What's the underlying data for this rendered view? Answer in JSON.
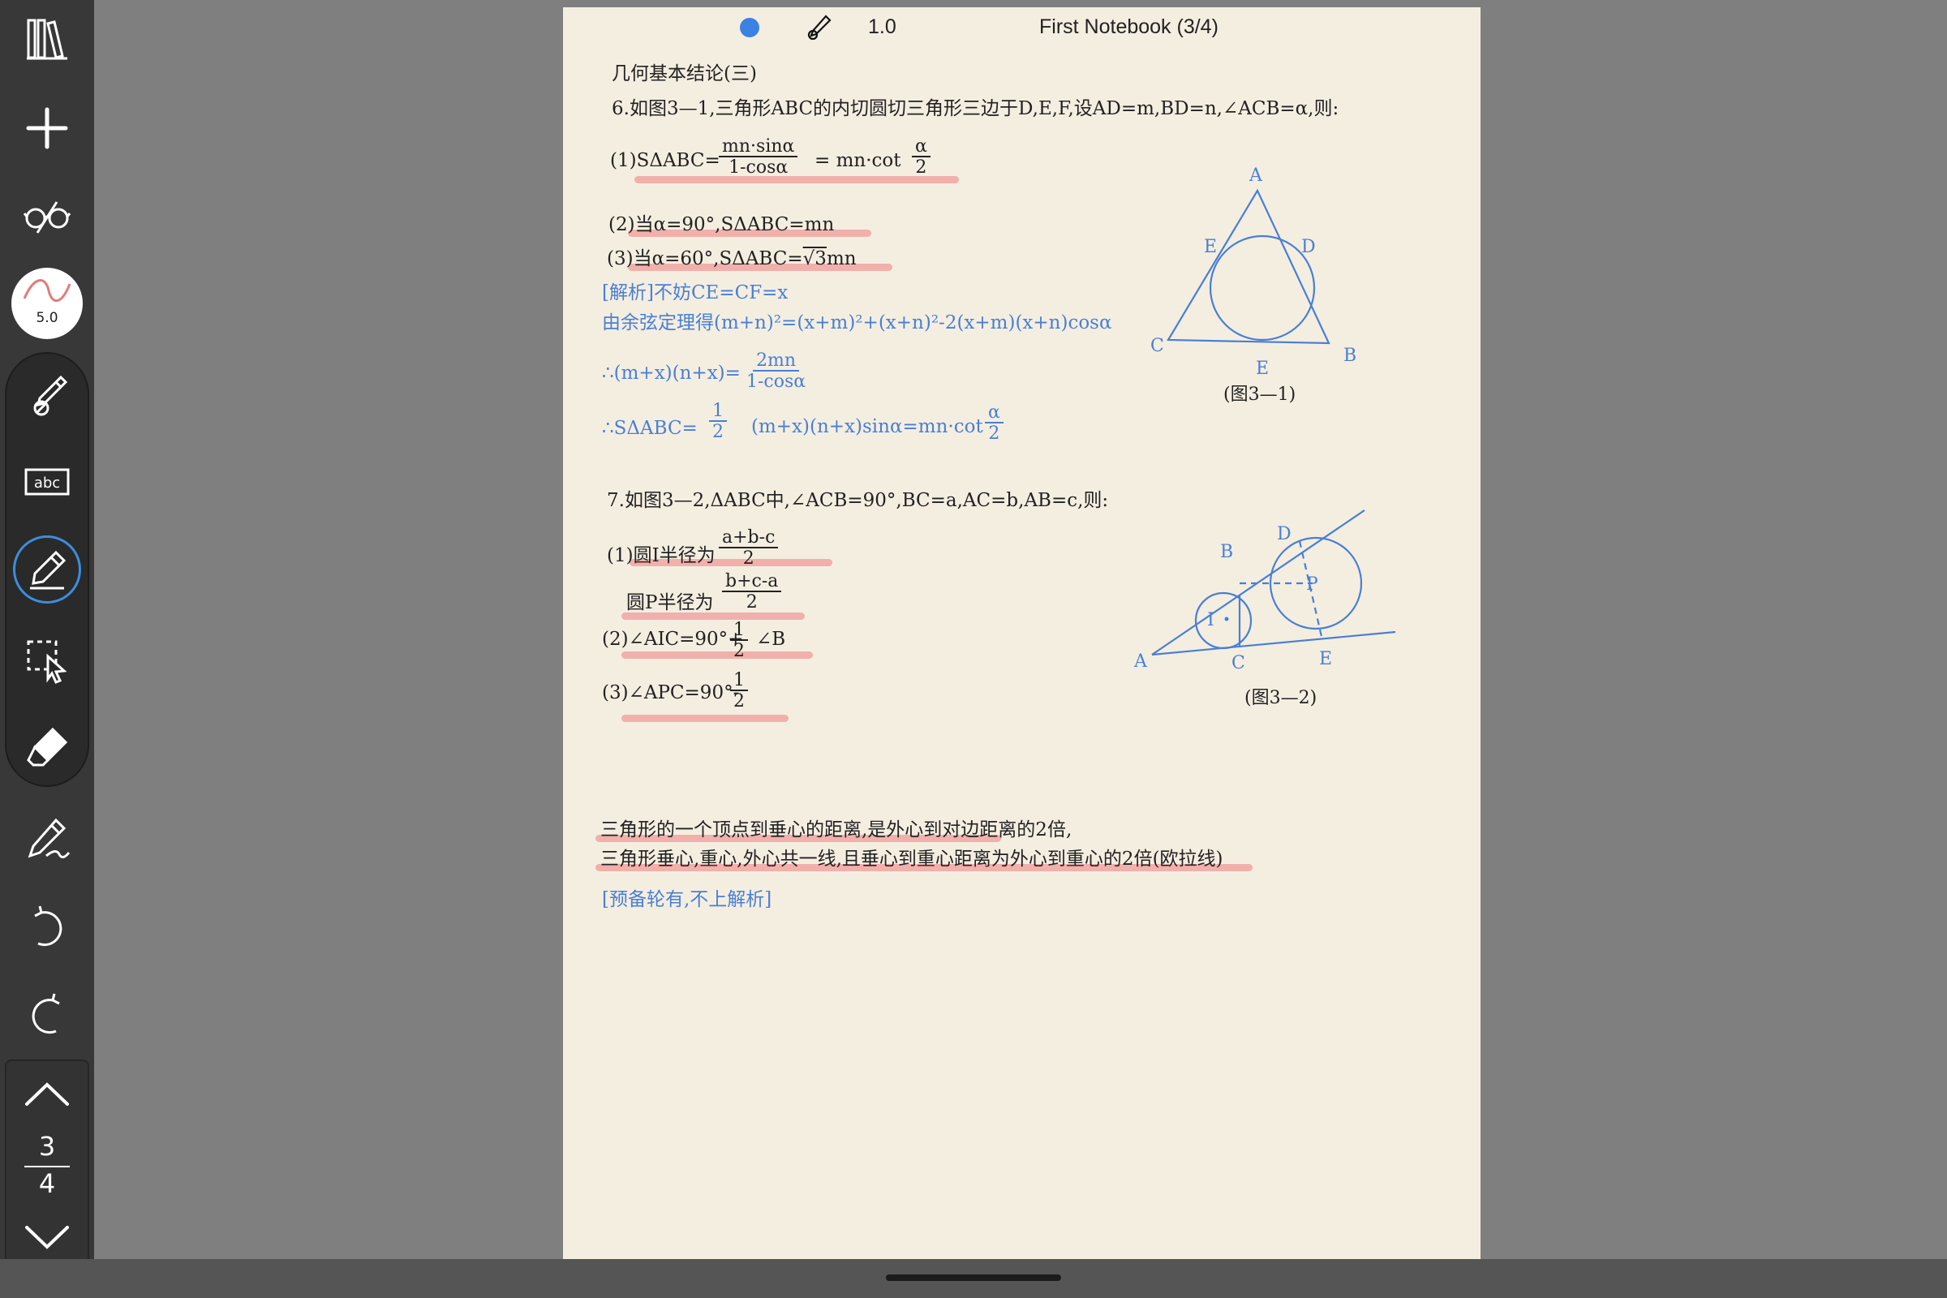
{
  "toolbar": {
    "brush_size": "5.0",
    "page_current": "3",
    "page_total": "4",
    "icons": [
      "library-icon",
      "add-icon",
      "reading-glasses-icon",
      "brush-size-icon",
      "pen-icon",
      "text-icon",
      "highlighter-icon",
      "lasso-select-icon",
      "eraser-icon",
      "pen-settings-icon",
      "undo-icon",
      "redo-icon",
      "page-up-icon",
      "page-down-icon"
    ]
  },
  "header": {
    "pen_color": "#3b82e2",
    "stroke_width": "1.0",
    "notebook_title": "First Notebook (3/4)"
  },
  "note": {
    "heading": "几何基本结论(三)",
    "p6": {
      "intro": "6.如图3—1,三角形ABC的内切圆切三角形三边于D,E,F,设AD=m,BD=n,∠ACB=α,则:",
      "f1_pre": "(1)SΔABC=",
      "f1_num": "mn·sinα",
      "f1_den": "1-cosα",
      "f1_mid": "= mn·cot",
      "f1_num2": "α",
      "f1_den2": "2",
      "f2": "(2)当α=90°,SΔABC=mn",
      "f3_pre": "(3)当α=60°,SΔABC=",
      "f3_root": "√3",
      "f3_post": "mn",
      "sol1": "[解析]不妨CE=CF=x",
      "sol2": "由余弦定理得(m+n)²=(x+m)²+(x+n)²-2(x+m)(x+n)cosα",
      "sol3_pre": "∴(m+x)(n+x)=",
      "sol3_num": "2mn",
      "sol3_den": "1-cosα",
      "sol4_pre": "∴SΔABC=",
      "sol4_num": "1",
      "sol4_den": "2",
      "sol4_mid": "(m+x)(n+x)sinα=mn·cot",
      "sol4_num2": "α",
      "sol4_den2": "2",
      "fig_caption": "(图3—1)",
      "fig_labels": {
        "A": "A",
        "B": "B",
        "C": "C",
        "D": "D",
        "E1": "E",
        "E2": "E"
      }
    },
    "p7": {
      "intro": "7.如图3—2,ΔABC中,∠ACB=90°,BC=a,AC=b,AB=c,则:",
      "r1_pre": "(1)圆I半径为",
      "r1_num": "a+b-c",
      "r1_den": "2",
      "r2_pre": "圆P半径为",
      "r2_num": "b+c-a",
      "r2_den": "2",
      "a2_pre": "(2)∠AIC=90°+",
      "a2_num": "1",
      "a2_den": "2",
      "a2_post": "∠B",
      "a3_pre": "(3)∠APC=90°-",
      "a3_num": "1",
      "a3_den": "2",
      "fig_caption": "(图3—2)",
      "fig_labels": {
        "A": "A",
        "B": "B",
        "C": "C",
        "D": "D",
        "E": "E",
        "I": "I",
        "P": "P"
      }
    },
    "euler1": "三角形的一个顶点到垂心的距离,是外心到对边距离的2倍,",
    "euler2": "三角形垂心,重心,外心共一线,且垂心到重心距离为外心到重心的2倍(欧拉线)",
    "reserve": "[预备轮有,不上解析]"
  },
  "colors": {
    "ink_blue": "#4a7fd3",
    "highlight": "#ee7e80",
    "paper": "#f4eee1",
    "toolbar": "#383838",
    "active": "#3b8ede"
  }
}
